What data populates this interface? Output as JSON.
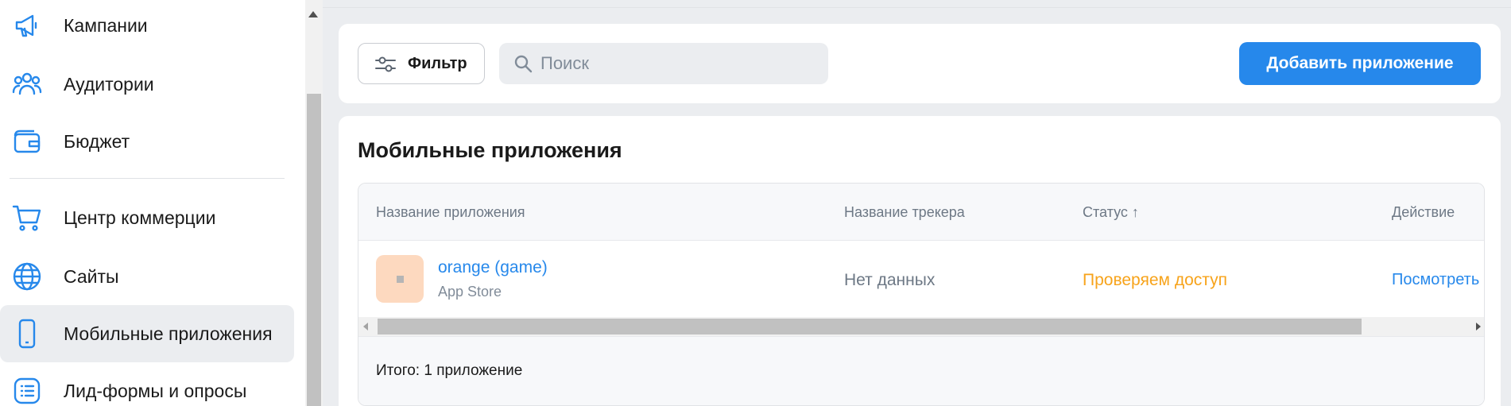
{
  "sidebar": {
    "items": [
      {
        "label": "Кампании",
        "icon": "megaphone-icon"
      },
      {
        "label": "Аудитории",
        "icon": "users-icon"
      },
      {
        "label": "Бюджет",
        "icon": "wallet-icon"
      },
      {
        "label": "Центр коммерции",
        "icon": "cart-icon"
      },
      {
        "label": "Сайты",
        "icon": "globe-icon"
      },
      {
        "label": "Мобильные приложения",
        "icon": "phone-icon",
        "active": true
      },
      {
        "label": "Лид-формы и опросы",
        "icon": "list-icon"
      }
    ]
  },
  "toolbar": {
    "filter_label": "Фильтр",
    "search_placeholder": "Поиск",
    "search_value": "",
    "add_label": "Добавить приложение"
  },
  "main": {
    "title": "Мобильные приложения",
    "columns": [
      "Название приложения",
      "Название трекера",
      "Статус ↑",
      "Действие"
    ],
    "rows": [
      {
        "app_name": "orange (game)",
        "store": "App Store",
        "tracker": "Нет данных",
        "status": "Проверяем доступ",
        "action": "Посмотреть"
      }
    ],
    "total": "Итого: 1 приложение"
  },
  "colors": {
    "accent": "#2688eb",
    "status_pending": "#f7a31a",
    "background": "#ebedf0",
    "app_thumb": "#fdd9bf"
  }
}
